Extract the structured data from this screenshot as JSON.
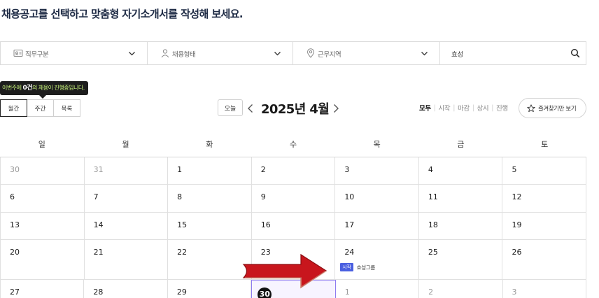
{
  "headline": "채용공고를 선택하고 맞춤형 자기소개서를 작성해 보세요.",
  "filters": {
    "job_category": "직무구분",
    "employment_type": "채용형태",
    "location": "근무지역",
    "search_value": "효성"
  },
  "tooltip": {
    "prefix": "이번주에 ",
    "count": "0건",
    "suffix": "의 채용이 진행중입니다."
  },
  "views": [
    "월간",
    "주간",
    "목록"
  ],
  "active_view": "월간",
  "today_label": "오늘",
  "month_title": "2025년 4월",
  "status_filters": [
    "모두",
    "시작",
    "마감",
    "상시",
    "진행"
  ],
  "active_status": "모두",
  "favorites_label": "즐겨찾기만 보기",
  "weekdays": [
    "일",
    "월",
    "화",
    "수",
    "목",
    "금",
    "토"
  ],
  "weeks": [
    [
      "30",
      "31",
      "1",
      "2",
      "3",
      "4",
      "5"
    ],
    [
      "6",
      "7",
      "8",
      "9",
      "10",
      "11",
      "12"
    ],
    [
      "13",
      "14",
      "15",
      "16",
      "17",
      "18",
      "19"
    ],
    [
      "20",
      "21",
      "22",
      "23",
      "24",
      "25",
      "26"
    ],
    [
      "27",
      "28",
      "29",
      "30",
      "1",
      "2",
      "3"
    ]
  ],
  "event": {
    "badge": "시작",
    "company": "효성그룹"
  },
  "colors": {
    "accent": "#4a5fe0",
    "tooltip_text": "#c7f27a",
    "arrow": "#c8161d",
    "selected_border": "#8e7cf0"
  }
}
